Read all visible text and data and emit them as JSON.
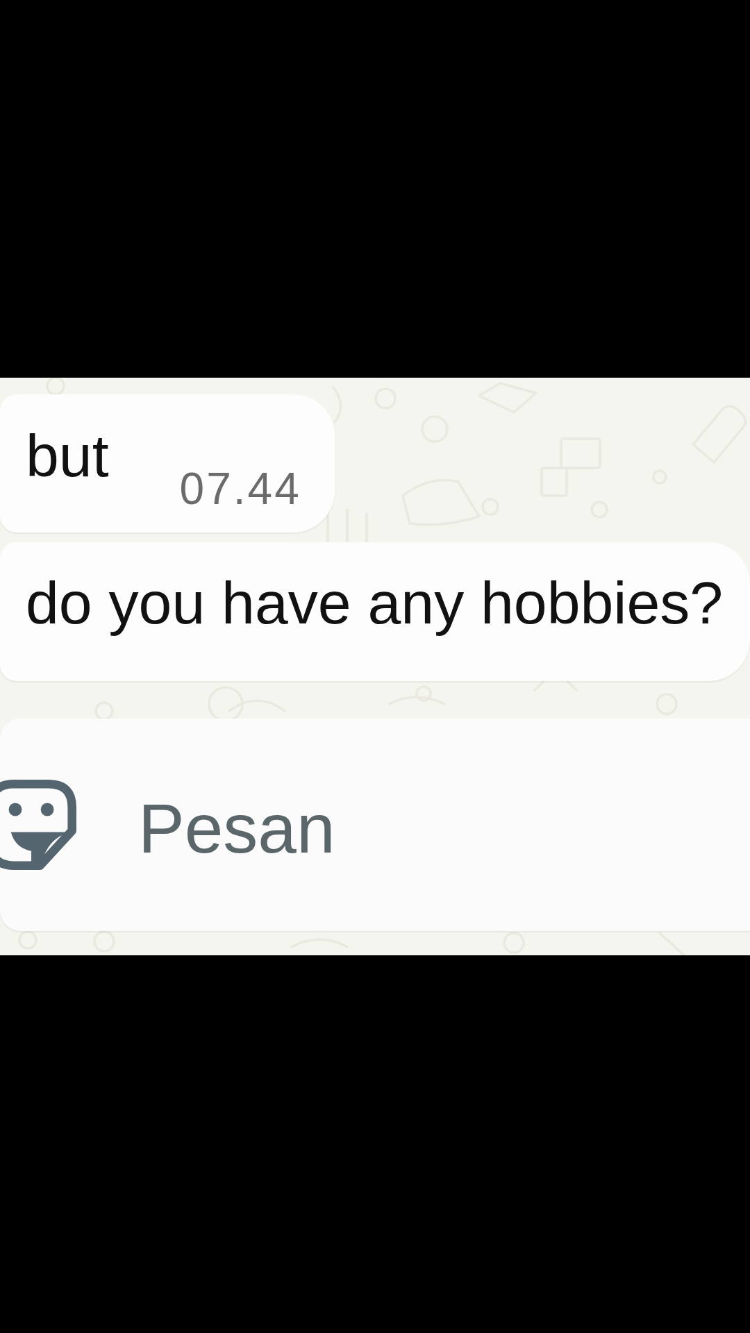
{
  "messages": [
    {
      "text": "but",
      "time": "07.44"
    },
    {
      "text": "do you have any hobbies?"
    }
  ],
  "composer": {
    "placeholder": "Pesan"
  }
}
